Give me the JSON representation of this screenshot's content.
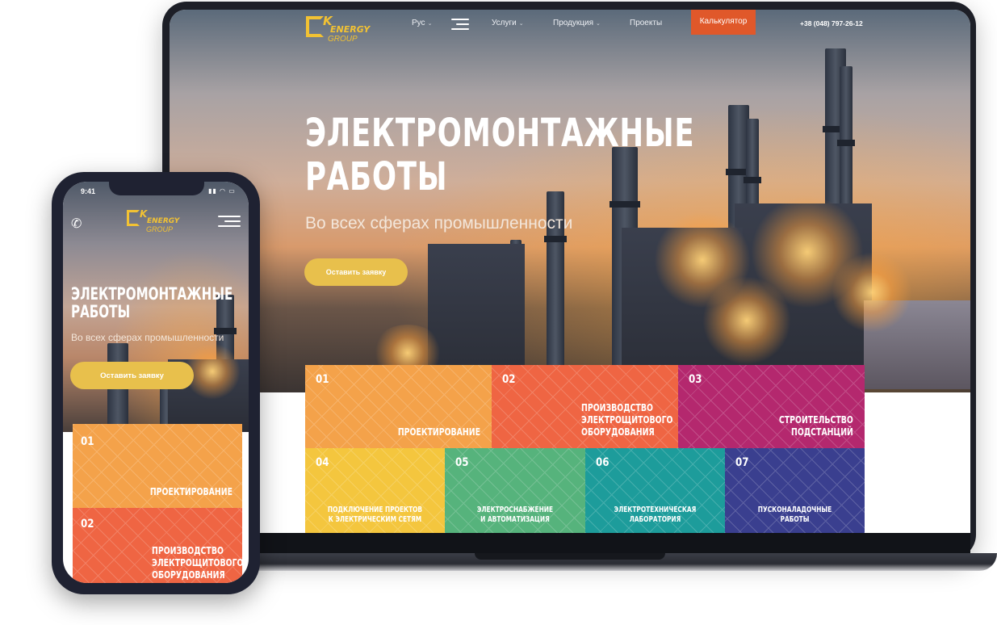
{
  "brand": {
    "logo_k": "K",
    "logo_energy": "ENERGY",
    "logo_group": "GROUP",
    "accent": "#f2c233"
  },
  "nav": {
    "lang": "Рус",
    "items": [
      {
        "label": "Услуги"
      },
      {
        "label": "Продукция"
      },
      {
        "label": "Проекты"
      }
    ],
    "calculator": "Калькулятор",
    "phone": "+38 (048) 797-26-12"
  },
  "hero": {
    "title_line1": "ЭЛЕКТРОМОНТАЖНЫЕ",
    "title_line2": "РАБОТЫ",
    "subtitle": "Во всех сферах промышленности",
    "cta": "Оставить заявку"
  },
  "services": [
    {
      "num": "01",
      "label_lines": [
        "ПРОЕКТИРОВАНИЕ"
      ],
      "color": "#f4a24a"
    },
    {
      "num": "02",
      "label_lines": [
        "ПРОИЗВОДСТВО",
        "ЭЛЕКТРОЩИТОВОГО",
        "ОБОРУДОВАНИЯ"
      ],
      "color": "#ef6543"
    },
    {
      "num": "03",
      "label_lines": [
        "СТРОИТЕЛЬСТВО",
        "ПОДСТАНЦИЙ"
      ],
      "color": "#b4286e"
    },
    {
      "num": "04",
      "label_lines": [
        "ПОДКЛЮЧЕНИЕ ПРОЕКТОВ",
        "К ЭЛЕКТРИЧЕСКИМ СЕТЯМ"
      ],
      "color": "#f4c63e"
    },
    {
      "num": "05",
      "label_lines": [
        "ЭЛЕКТРОСНАБЖЕНИЕ",
        "И АВТОМАТИЗАЦИЯ"
      ],
      "color": "#56b37c"
    },
    {
      "num": "06",
      "label_lines": [
        "ЭЛЕКТРОТЕХНИЧЕСКАЯ",
        "ЛАБОРАТОРИЯ"
      ],
      "color": "#1d9c9b"
    },
    {
      "num": "07",
      "label_lines": [
        "ПУСКОНАЛАДОЧНЫЕ",
        "РАБОТЫ"
      ],
      "color": "#3a3f8f"
    }
  ],
  "phone_device": {
    "time": "9:41",
    "status_icons": "signal-wifi-battery-icons"
  },
  "icons": {
    "phone": "phone-icon",
    "menu": "hamburger-menu-icon"
  }
}
